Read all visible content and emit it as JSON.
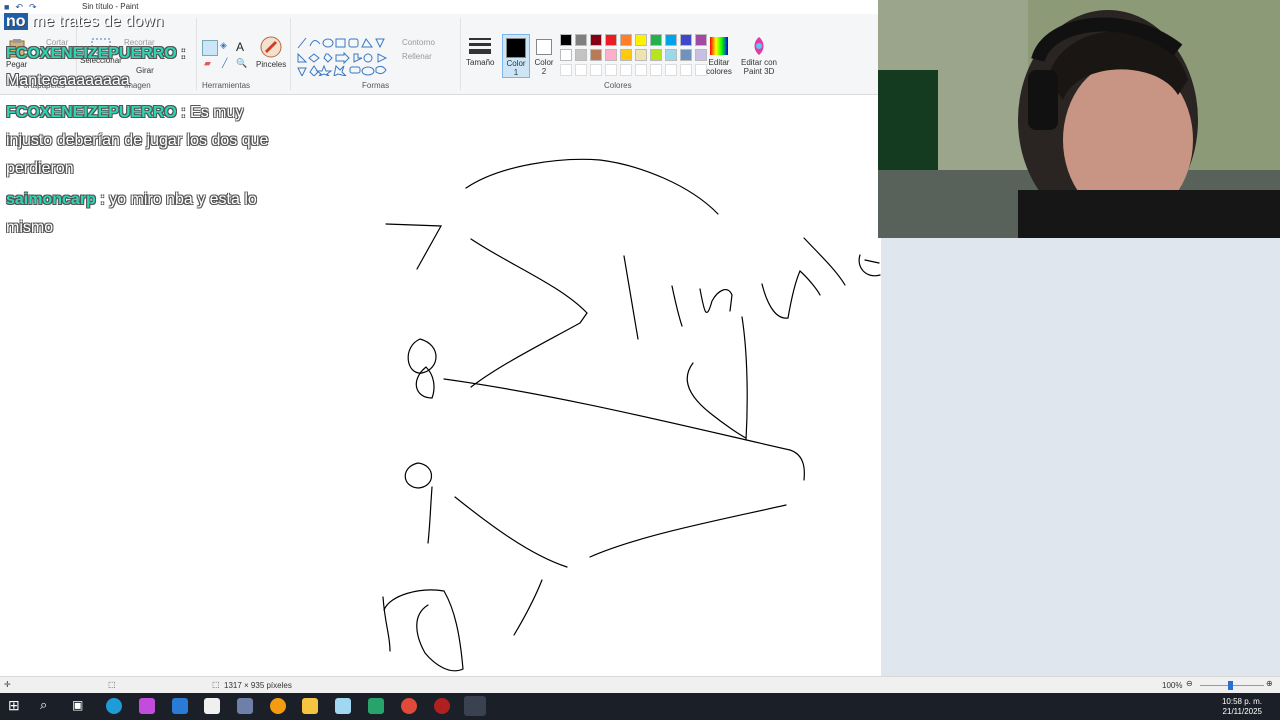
{
  "window": {
    "title": "Sin título - Paint"
  },
  "ribbon": {
    "clipboard": {
      "paste": "Pegar",
      "cut": "Cortar",
      "label": "Portapapeles"
    },
    "image": {
      "select": "Seleccionar",
      "crop": "Recortar",
      "rotate": "Girar",
      "label": "Imagen"
    },
    "tools": {
      "label": "Herramientas",
      "text_tool": "A"
    },
    "brushes": {
      "label": "Pinceles"
    },
    "shapes": {
      "label": "Formas",
      "outline": "Contorno",
      "fill": "Rellenar"
    },
    "size": {
      "label": "Tamaño"
    },
    "color1": {
      "label": "Color",
      "label2": "1"
    },
    "color2": {
      "label": "Color",
      "label2": "2"
    },
    "colors": {
      "label": "Colores"
    },
    "edit_colors": {
      "label": "Editar",
      "label2": "colores"
    },
    "paint3d": {
      "label": "Editar con",
      "label2": "Paint 3D"
    }
  },
  "palette": [
    "#000000",
    "#7f7f7f",
    "#880015",
    "#ed1c24",
    "#ff7f27",
    "#fff200",
    "#22b14c",
    "#00a2e8",
    "#3f48cc",
    "#a349a4",
    "#ffffff",
    "#c3c3c3",
    "#b97a57",
    "#ffaec9",
    "#ffc90e",
    "#efe4b0",
    "#b5e61d",
    "#99d9ea",
    "#7092be",
    "#c8bfe7"
  ],
  "status": {
    "dimensions": "1317 × 935 píxeles",
    "zoom": "100%"
  },
  "taskbar": {
    "time": "10:58 p. m.",
    "date": "21/11/2025"
  },
  "overlay": {
    "banner_bold": "no",
    "banner_text": "me trates de down",
    "messages": [
      {
        "user": "FCOXENEIZEPUERRO",
        "text": ":"
      },
      {
        "user": "",
        "text": "Mantecaaaaaaaa"
      },
      {
        "user": "FCOXENEIZEPUERRO",
        "text": ": Es muy injusto deberían de jugar los dos que perdieron"
      },
      {
        "user": "saimoncarp",
        "text": ": yo miro nba y esta lo mismo"
      }
    ]
  }
}
